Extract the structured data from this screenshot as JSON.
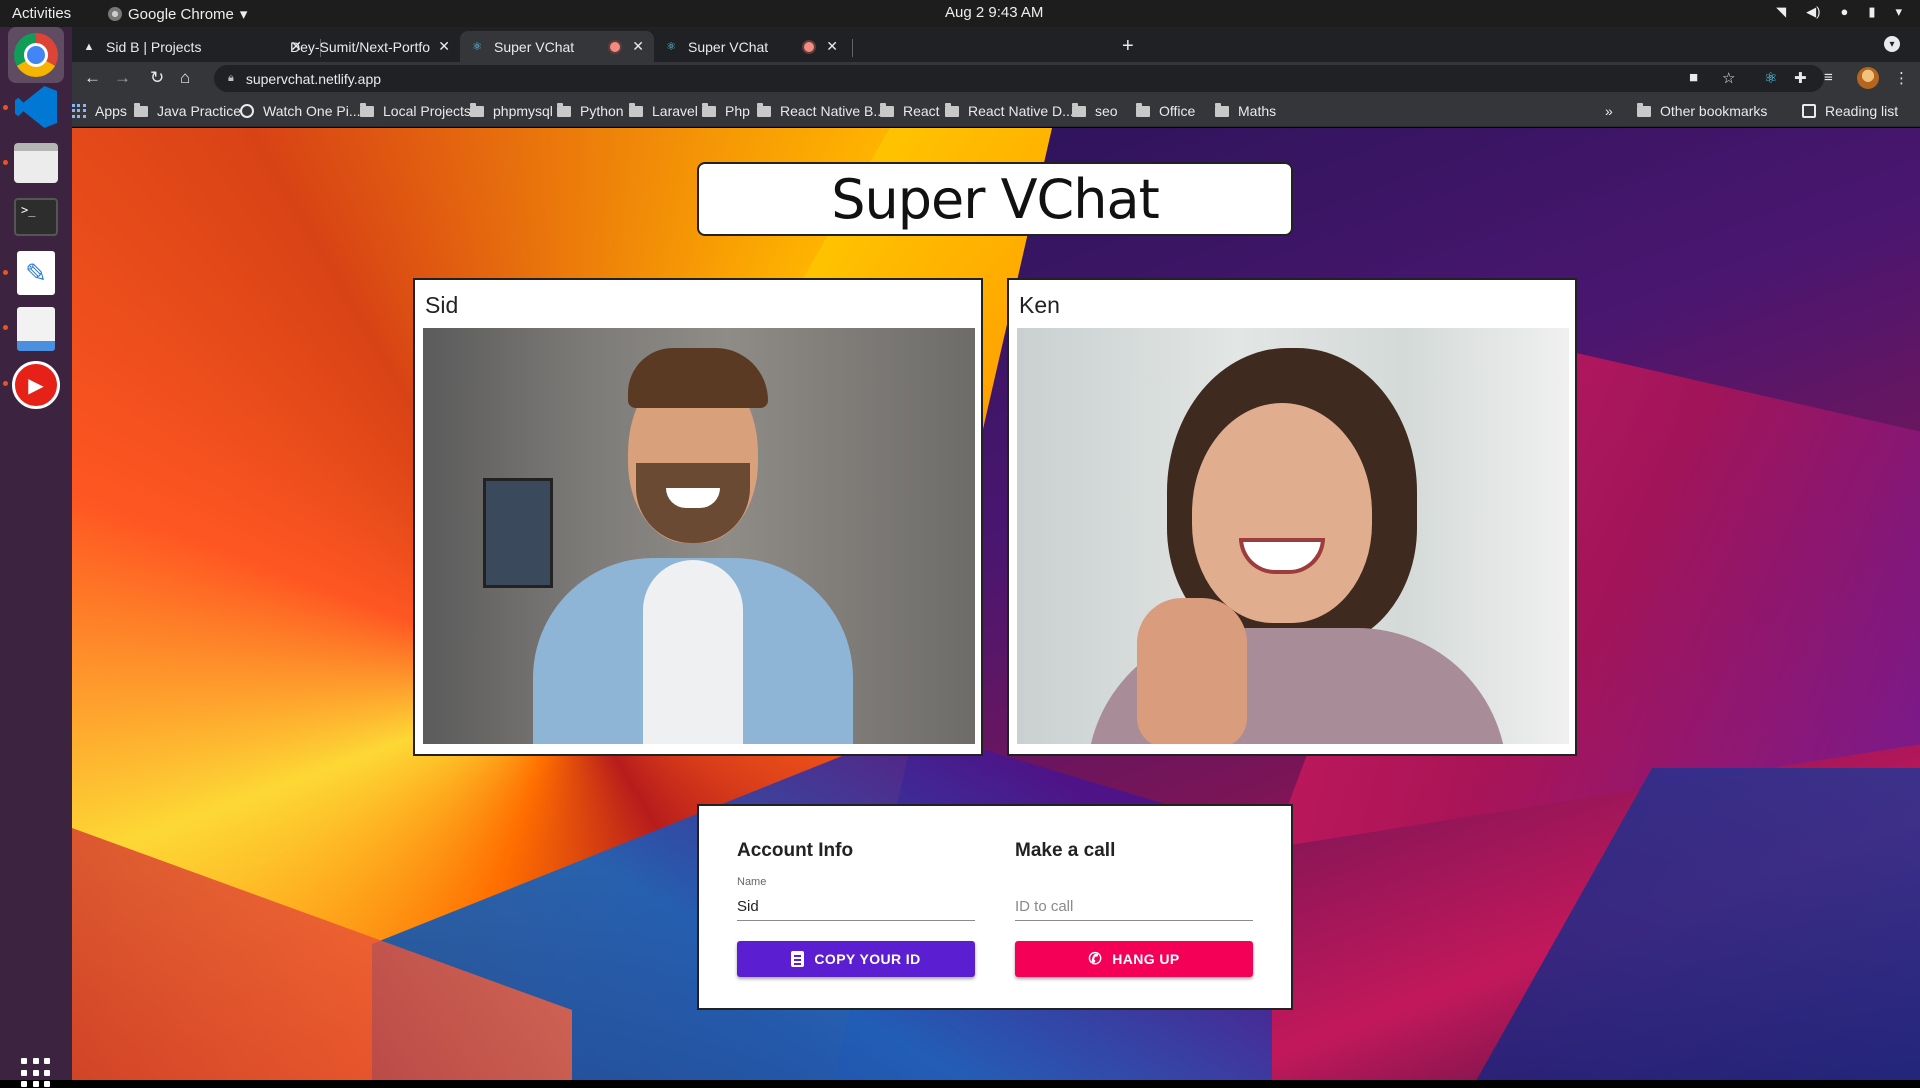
{
  "system": {
    "activities": "Activities",
    "app_name": "Google Chrome",
    "clock": "Aug 2  9:43 AM"
  },
  "tabs": [
    {
      "title": "Sid B | Projects",
      "favicon": "triangle-icon",
      "active": false
    },
    {
      "title": "Dey-Sumit/Next-Portfolio",
      "favicon": "github-icon",
      "active": false
    },
    {
      "title": "Super VChat",
      "favicon": "react-icon",
      "active": true,
      "recording": true
    },
    {
      "title": "Super VChat",
      "favicon": "react-icon",
      "active": false,
      "recording": true
    }
  ],
  "toolbar": {
    "url": "supervchat.netlify.app"
  },
  "bookmarks": [
    {
      "label": "Apps",
      "icon": "apps-grid-icon"
    },
    {
      "label": "Java Practice",
      "icon": "folder-icon"
    },
    {
      "label": "Watch One Pi...",
      "icon": "globe-icon"
    },
    {
      "label": "Local Projects",
      "icon": "folder-icon"
    },
    {
      "label": "phpmysql",
      "icon": "folder-icon"
    },
    {
      "label": "Python",
      "icon": "folder-icon"
    },
    {
      "label": "Laravel",
      "icon": "folder-icon"
    },
    {
      "label": "Php",
      "icon": "folder-icon"
    },
    {
      "label": "React Native B...",
      "icon": "folder-icon"
    },
    {
      "label": "React",
      "icon": "folder-icon"
    },
    {
      "label": "React Native D...",
      "icon": "folder-icon"
    },
    {
      "label": "seo",
      "icon": "folder-icon"
    },
    {
      "label": "Office",
      "icon": "folder-icon"
    },
    {
      "label": "Maths",
      "icon": "folder-icon"
    }
  ],
  "bookmarks_overflow": "»",
  "other_bookmarks": "Other bookmarks",
  "reading_list": "Reading list",
  "app": {
    "title": "Super VChat",
    "local_video": {
      "name": "Sid"
    },
    "remote_video": {
      "name": "Ken"
    },
    "account": {
      "heading": "Account Info",
      "name_label": "Name",
      "name_value": "Sid",
      "copy_button": "COPY YOUR ID"
    },
    "call": {
      "heading": "Make a call",
      "id_placeholder": "ID to call",
      "id_value": "",
      "hangup_button": "HANG UP"
    }
  },
  "colors": {
    "copy_button": "#5b1fd1",
    "hangup_button": "#f50057"
  }
}
